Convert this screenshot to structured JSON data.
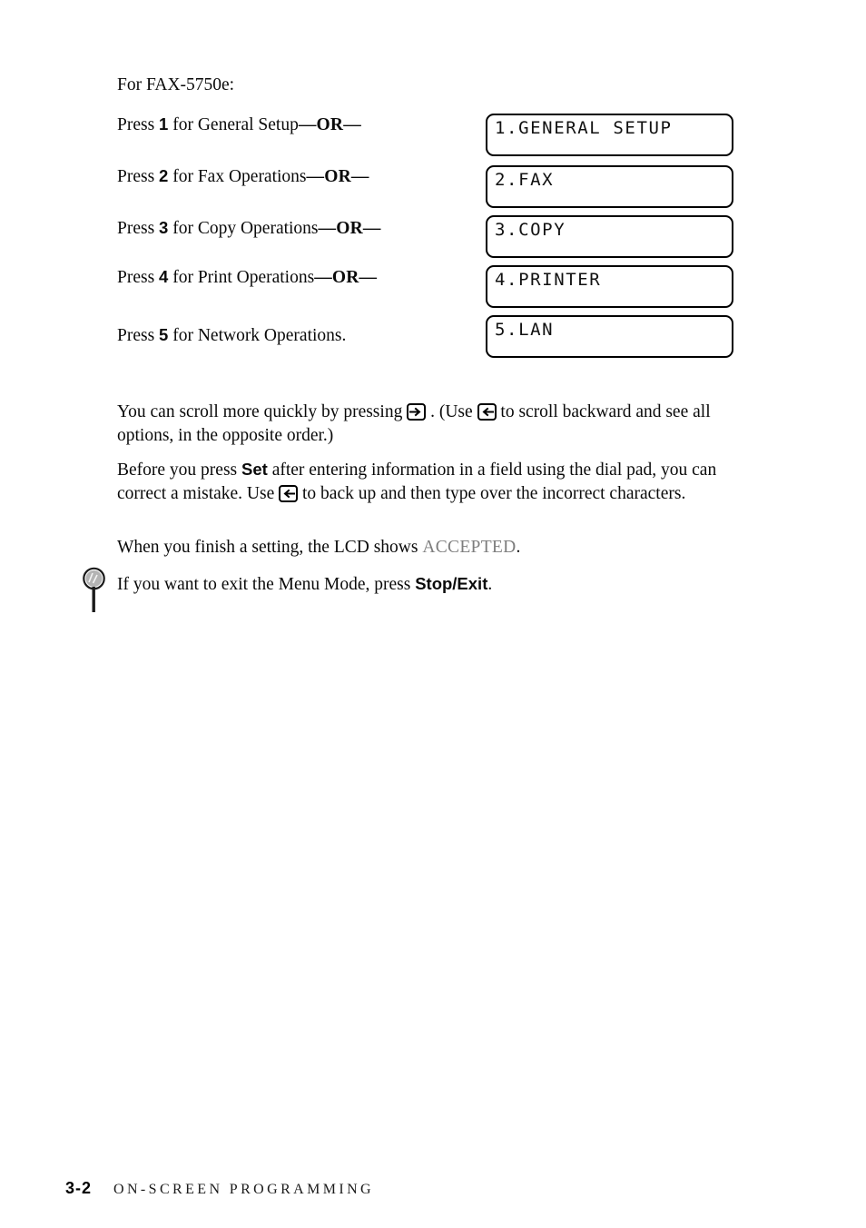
{
  "document": {
    "intro_line": "For FAX-5750e:",
    "steps": [
      {
        "prefix": "Press ",
        "key": "1",
        "middle": " for General Setup",
        "suffix": "—OR—",
        "lcd": "1.GENERAL SETUP"
      },
      {
        "prefix": "Press ",
        "key": "2",
        "middle": " for Fax Operations",
        "suffix": "—OR—",
        "lcd": "2.FAX"
      },
      {
        "prefix": "Press ",
        "key": "3",
        "middle": " for Copy Operations",
        "suffix": "—OR—",
        "lcd": "3.COPY"
      },
      {
        "prefix": "Press ",
        "key": "4",
        "middle": " for Print Operations",
        "suffix": "—OR—",
        "lcd": "4.PRINTER"
      },
      {
        "prefix": "Press ",
        "key": "5",
        "middle": " for Network Operations.",
        "suffix": "",
        "lcd": "5.LAN"
      }
    ],
    "paragraphs": {
      "scroll": {
        "part1": "You can scroll more quickly by pressing ",
        "icon1": "right-arrow-key-icon",
        "part2": " . (Use ",
        "icon2": "left-arrow-key-icon",
        "part3": " to scroll backward and see all options, in the opposite order.)"
      },
      "correct": {
        "part1": "Before you press ",
        "bold1": "Set",
        "part2": " after entering information in a field using the dial pad, you can correct a mistake. Use ",
        "icon1": "left-arrow-key-icon",
        "part3": " to back up and then type over the incorrect characters."
      },
      "accepted": {
        "part1": "When you finish a setting, the LCD shows ",
        "status": "ACCEPTED",
        "part2": "."
      },
      "exit": {
        "part1": "If you want to exit the Menu Mode, press ",
        "bold1": "Stop/Exit",
        "part2": "."
      }
    },
    "footer": {
      "page_number": "3-2",
      "chapter_name": "ON-SCREEN PROGRAMMING"
    },
    "colors": {
      "accepted_gray": "#7d7d7d",
      "text_black": "#0a0a0a",
      "lens_gray": "#b4b4b4"
    }
  }
}
